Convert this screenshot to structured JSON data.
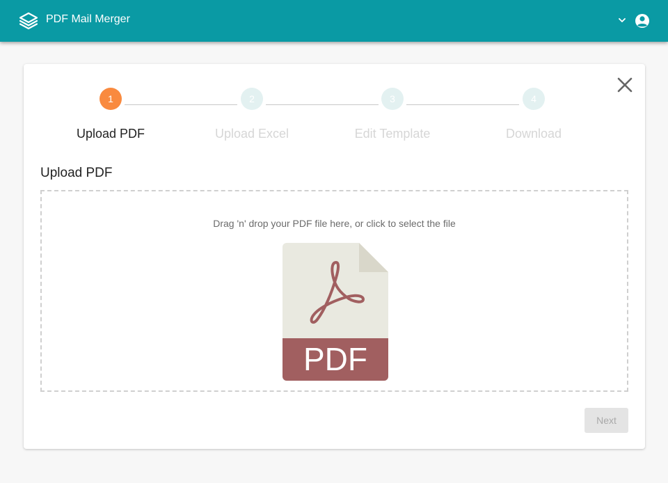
{
  "app": {
    "title": "PDF Mail Merger"
  },
  "header": {
    "icons": [
      "layers-icon",
      "chevron-down-icon",
      "account-circle-icon"
    ]
  },
  "colors": {
    "appbar": "#0a9aa4",
    "step_active": "#f98a3f",
    "step_inactive": "#e3f1f1",
    "pdf_red": "#a15f60"
  },
  "stepper": {
    "steps": [
      {
        "number": "1",
        "label": "Upload PDF",
        "state": "active"
      },
      {
        "number": "2",
        "label": "Upload Excel",
        "state": "inactive"
      },
      {
        "number": "3",
        "label": "Edit Template",
        "state": "inactive"
      },
      {
        "number": "4",
        "label": "Download",
        "state": "inactive"
      }
    ]
  },
  "main": {
    "section_title": "Upload PDF",
    "dropzone_hint": "Drag 'n' drop your PDF file here, or click to select the file",
    "pdf_badge": "PDF",
    "next_label": "Next"
  }
}
